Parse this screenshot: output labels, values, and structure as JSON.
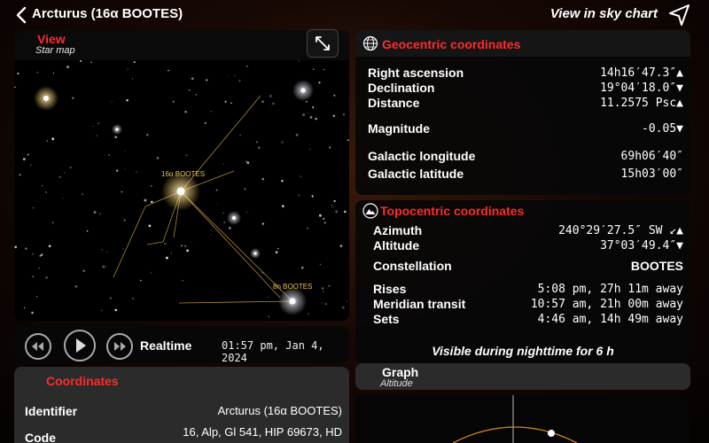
{
  "header": {
    "title": "Arcturus (16α BOOTES)",
    "sky_chart_label": "View in sky chart"
  },
  "view": {
    "title": "View",
    "subtitle": "Star map",
    "labels": [
      "16α BOOTES",
      "8η BOOTES"
    ]
  },
  "playback": {
    "realtime_label": "Realtime",
    "datetime": "01:57 pm, Jan 4, 2024"
  },
  "coordinates": {
    "title": "Coordinates",
    "identifier_label": "Identifier",
    "identifier_value": "Arcturus (16α BOOTES)",
    "code_label": "Code",
    "code_value": "16, Alp, Gl 541, HIP 69673, HD"
  },
  "geocentric": {
    "title": "Geocentric coordinates",
    "rows": [
      {
        "label": "Right ascension",
        "value": "14h16′47.3″▲"
      },
      {
        "label": "Declination",
        "value": "19°04′18.0″▼"
      },
      {
        "label": "Distance",
        "value": "11.2575 Psc▲"
      },
      {
        "label": "Magnitude",
        "value": "-0.05▼"
      },
      {
        "label": "Galactic longitude",
        "value": "69h06′40″"
      },
      {
        "label": "Galactic latitude",
        "value": "15h03′00″"
      }
    ]
  },
  "topocentric": {
    "title": "Topocentric coordinates",
    "rows": [
      {
        "label": "Azimuth",
        "value": "240°29′27.5″ SW ↙▲"
      },
      {
        "label": "Altitude",
        "value": "37°03′49.4″▼"
      },
      {
        "label": "Constellation",
        "value": "BOOTES"
      },
      {
        "label": "Rises",
        "value": "5:08 pm, 27h 11m away"
      },
      {
        "label": "Meridian transit",
        "value": "10:57 am, 21h 00m away"
      },
      {
        "label": "Sets",
        "value": "4:46 am, 14h 49m away"
      }
    ],
    "visible_note": "Visible during nighttime for 6 h"
  },
  "graph": {
    "title": "Graph",
    "subtitle": "Altitude"
  },
  "colors": {
    "accent": "#ff2b2b",
    "star_label": "#e6c14a",
    "constellation_line": "#c9a23a"
  },
  "icons": [
    "back-chevron-icon",
    "location-arrow-icon",
    "expand-icon",
    "globe-icon",
    "mountain-icon",
    "rewind-icon",
    "play-icon",
    "fast-forward-icon"
  ]
}
